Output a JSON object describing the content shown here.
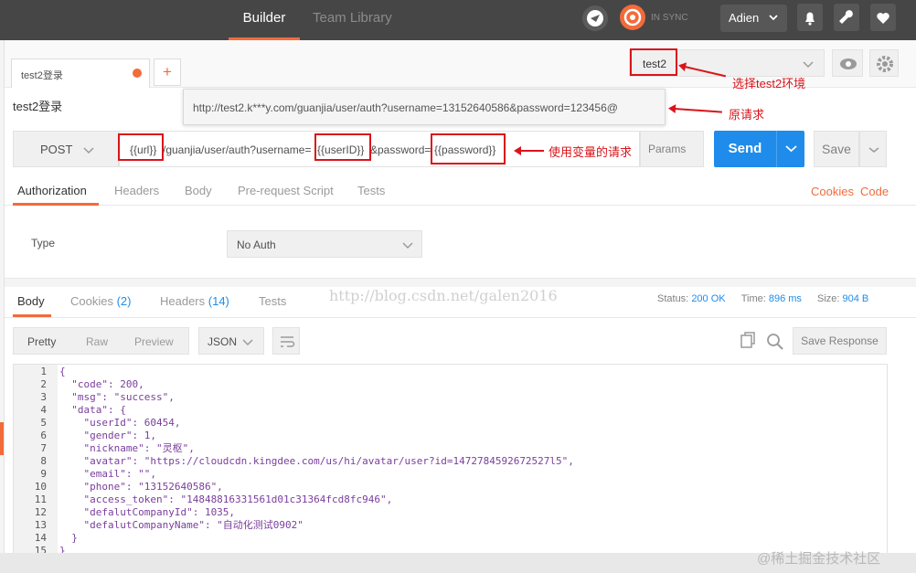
{
  "topbar": {
    "tabs": [
      "Builder",
      "Team Library"
    ],
    "sync_label": "IN SYNC",
    "user": "Adien"
  },
  "request_tab": {
    "label": "test2登录",
    "add_label": "+"
  },
  "environment": {
    "selected": "test2"
  },
  "request_name": "test2登录",
  "original_url": "http://test2.k***y.com/guanjia/user/auth?username=13152640586&password=123456@",
  "request": {
    "method": "POST",
    "url_parts": [
      "{{url}}",
      "/guanjia/user/auth?username=",
      "{{userID}}",
      "&password=",
      "{{password}}"
    ],
    "params_label": "Params",
    "send_label": "Send",
    "save_label": "Save"
  },
  "annotations": {
    "env": "选择test2环境",
    "original": "原请求",
    "variables": "使用变量的请求"
  },
  "req_tabs": [
    "Authorization",
    "Headers",
    "Body",
    "Pre-request Script",
    "Tests"
  ],
  "req_links": [
    "Cookies",
    "Code"
  ],
  "auth": {
    "type_label": "Type",
    "type_value": "No Auth"
  },
  "watermark": "http://blog.csdn.net/galen2016",
  "resp_tabs": {
    "body": "Body",
    "cookies": "Cookies",
    "cookies_count": "(2)",
    "headers": "Headers",
    "headers_count": "(14)",
    "tests": "Tests"
  },
  "resp_status": {
    "status_label": "Status:",
    "status_value": "200 OK",
    "time_label": "Time:",
    "time_value": "896 ms",
    "size_label": "Size:",
    "size_value": "904 B"
  },
  "view_modes": [
    "Pretty",
    "Raw",
    "Preview"
  ],
  "format": "JSON",
  "save_response_label": "Save Response",
  "code_lines": [
    {
      "n": "1",
      "t": "{"
    },
    {
      "n": "2",
      "t": "  \"code\": 200,"
    },
    {
      "n": "3",
      "t": "  \"msg\": \"success\","
    },
    {
      "n": "4",
      "t": "  \"data\": {"
    },
    {
      "n": "5",
      "t": "    \"userId\": 60454,"
    },
    {
      "n": "6",
      "t": "    \"gender\": 1,"
    },
    {
      "n": "7",
      "t": "    \"nickname\": \"灵枢\","
    },
    {
      "n": "8",
      "t": "    \"avatar\": \"https://cloudcdn.kingdee.com/us/hi/avatar/user?id=1472784592672527l5\","
    },
    {
      "n": "9",
      "t": "    \"email\": \"\","
    },
    {
      "n": "10",
      "t": "    \"phone\": \"13152640586\","
    },
    {
      "n": "11",
      "t": "    \"access_token\": \"14848816331561d01c31364fcd8fc946\","
    },
    {
      "n": "12",
      "t": "    \"defalutCompanyId\": 1035,"
    },
    {
      "n": "13",
      "t": "    \"defalutCompanyName\": \"自动化测试0902\""
    },
    {
      "n": "14",
      "t": "  }"
    },
    {
      "n": "15",
      "t": "}"
    }
  ],
  "corner_watermark": "@稀土掘金技术社区",
  "colors": {
    "accent": "#f26b3a",
    "send_blue": "#1f8ceb",
    "annotation": "#d9141b",
    "topbar": "#464646"
  }
}
